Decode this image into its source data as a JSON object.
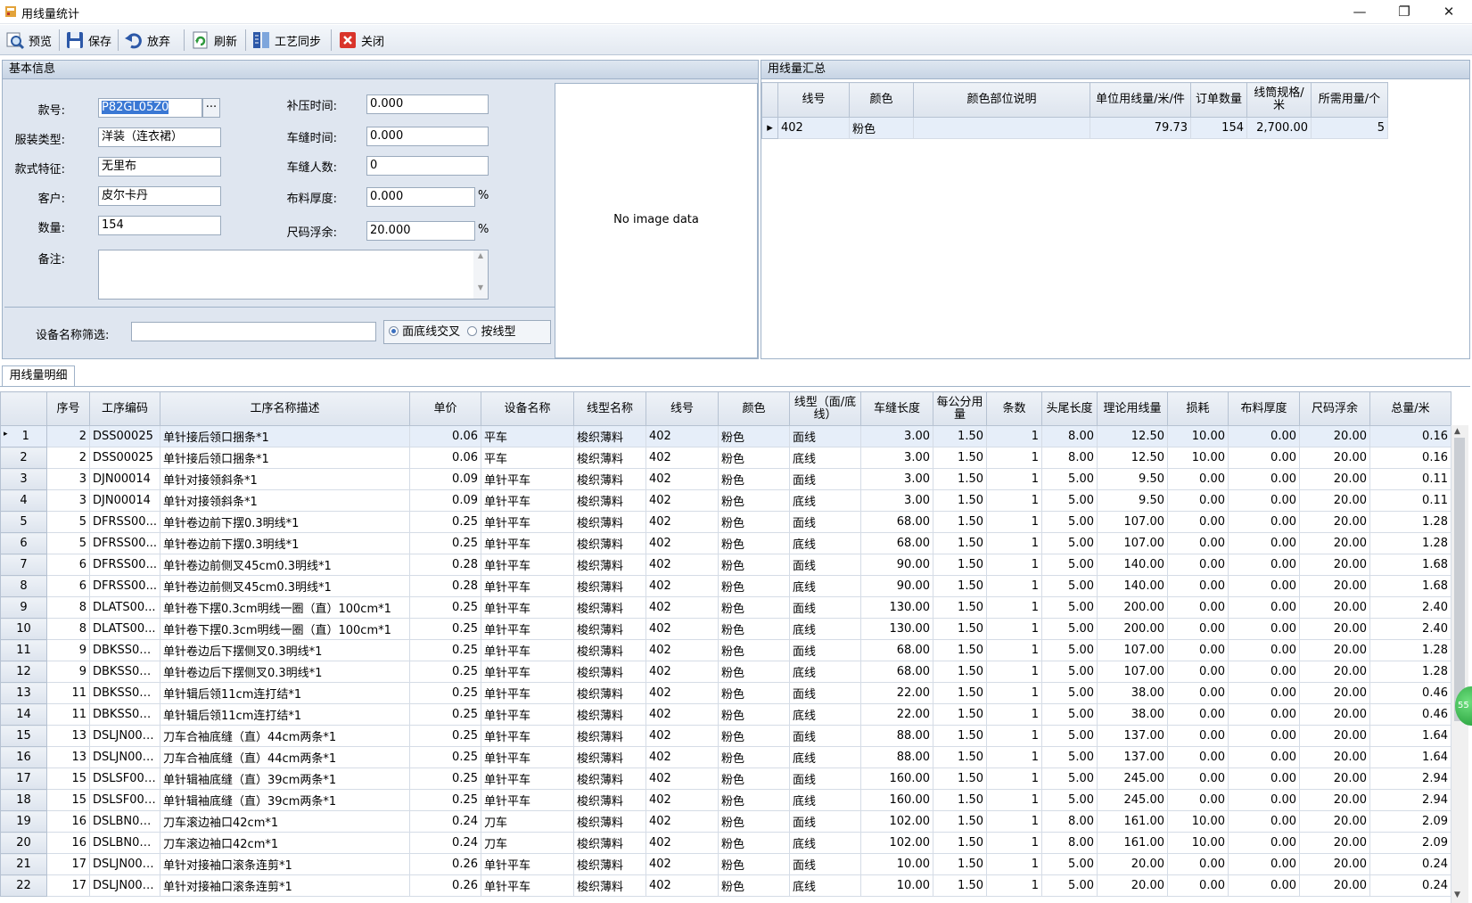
{
  "window": {
    "title": "用线量统计",
    "min": "—",
    "max": "❐",
    "close": "✕"
  },
  "toolbar": {
    "preview": "预览",
    "save": "保存",
    "discard": "放弃",
    "refresh": "刷新",
    "sync": "工艺同步",
    "close": "关闭"
  },
  "basic": {
    "header": "基本信息",
    "style_no_label": "款号:",
    "style_no": "P82GL05Z0",
    "browse": "···",
    "garment_type_label": "服装类型:",
    "garment_type": "洋装（连衣裙）",
    "feature_label": "款式特征:",
    "feature": "无里布",
    "customer_label": "客户:",
    "customer": "皮尔卡丹",
    "quantity_label": "数量:",
    "quantity": "154",
    "remark_label": "备注:",
    "remark": "",
    "press_time_label": "补压时间:",
    "press_time": "0.000",
    "sew_time_label": "车缝时间:",
    "sew_time": "0.000",
    "sew_people_label": "车缝人数:",
    "sew_people": "0",
    "fabric_thick_label": "布料厚度:",
    "fabric_thick": "0.000",
    "size_float_label": "尺码浮余:",
    "size_float": "20.000",
    "pct": "%",
    "device_filter_label": "设备名称筛选:",
    "device_filter": "",
    "radio_cross": "面底线交叉",
    "radio_by_type": "按线型",
    "no_image": "No image data"
  },
  "summary": {
    "header": "用线量汇总",
    "columns": [
      "线号",
      "颜色",
      "颜色部位说明",
      "单位用线量/米/件",
      "订单数量",
      "线筒规格/米",
      "所需用量/个"
    ],
    "rows": [
      [
        "402",
        "粉色",
        "",
        "79.73",
        "154",
        "2,700.00",
        "5"
      ]
    ]
  },
  "detail": {
    "tab": "用线量明细",
    "columns": [
      "序号",
      "工序编码",
      "工序名称描述",
      "单价",
      "设备名称",
      "线型名称",
      "线号",
      "颜色",
      "线型（面/底线）",
      "车缝长度",
      "每公分用量",
      "条数",
      "头尾长度",
      "理论用线量",
      "损耗",
      "布料厚度",
      "尺码浮余",
      "总量/米"
    ],
    "rows": [
      [
        "1",
        "2",
        "DSS00025",
        "单针接后领口捆条*1",
        "0.06",
        "平车",
        "梭织薄料",
        "402",
        "粉色",
        "面线",
        "3.00",
        "1.50",
        "1",
        "8.00",
        "12.50",
        "10.00",
        "0.00",
        "20.00",
        "0.16"
      ],
      [
        "2",
        "2",
        "DSS00025",
        "单针接后领口捆条*1",
        "0.06",
        "平车",
        "梭织薄料",
        "402",
        "粉色",
        "底线",
        "3.00",
        "1.50",
        "1",
        "8.00",
        "12.50",
        "10.00",
        "0.00",
        "20.00",
        "0.16"
      ],
      [
        "3",
        "3",
        "DJN00014",
        "单针对接领斜条*1",
        "0.09",
        "单针平车",
        "梭织薄料",
        "402",
        "粉色",
        "面线",
        "3.00",
        "1.50",
        "1",
        "5.00",
        "9.50",
        "0.00",
        "0.00",
        "20.00",
        "0.11"
      ],
      [
        "4",
        "3",
        "DJN00014",
        "单针对接领斜条*1",
        "0.09",
        "单针平车",
        "梭织薄料",
        "402",
        "粉色",
        "底线",
        "3.00",
        "1.50",
        "1",
        "5.00",
        "9.50",
        "0.00",
        "0.00",
        "20.00",
        "0.11"
      ],
      [
        "5",
        "5",
        "DFRSS00...",
        "单针卷边前下摆0.3明线*1",
        "0.25",
        "单针平车",
        "梭织薄料",
        "402",
        "粉色",
        "面线",
        "68.00",
        "1.50",
        "1",
        "5.00",
        "107.00",
        "0.00",
        "0.00",
        "20.00",
        "1.28"
      ],
      [
        "6",
        "5",
        "DFRSS00...",
        "单针卷边前下摆0.3明线*1",
        "0.25",
        "单针平车",
        "梭织薄料",
        "402",
        "粉色",
        "底线",
        "68.00",
        "1.50",
        "1",
        "5.00",
        "107.00",
        "0.00",
        "0.00",
        "20.00",
        "1.28"
      ],
      [
        "7",
        "6",
        "DFRSS00...",
        "单针卷边前侧叉45cm0.3明线*1",
        "0.28",
        "单针平车",
        "梭织薄料",
        "402",
        "粉色",
        "面线",
        "90.00",
        "1.50",
        "1",
        "5.00",
        "140.00",
        "0.00",
        "0.00",
        "20.00",
        "1.68"
      ],
      [
        "8",
        "6",
        "DFRSS00...",
        "单针卷边前侧叉45cm0.3明线*1",
        "0.28",
        "单针平车",
        "梭织薄料",
        "402",
        "粉色",
        "底线",
        "90.00",
        "1.50",
        "1",
        "5.00",
        "140.00",
        "0.00",
        "0.00",
        "20.00",
        "1.68"
      ],
      [
        "9",
        "8",
        "DLATS00...",
        "单针卷下摆0.3cm明线一圈（直）100cm*1",
        "0.25",
        "单针平车",
        "梭织薄料",
        "402",
        "粉色",
        "面线",
        "130.00",
        "1.50",
        "1",
        "5.00",
        "200.00",
        "0.00",
        "0.00",
        "20.00",
        "2.40"
      ],
      [
        "10",
        "8",
        "DLATS00...",
        "单针卷下摆0.3cm明线一圈（直）100cm*1",
        "0.25",
        "单针平车",
        "梭织薄料",
        "402",
        "粉色",
        "底线",
        "130.00",
        "1.50",
        "1",
        "5.00",
        "200.00",
        "0.00",
        "0.00",
        "20.00",
        "2.40"
      ],
      [
        "11",
        "9",
        "DBKSS00...",
        "单针卷边后下摆侧叉0.3明线*1",
        "0.25",
        "单针平车",
        "梭织薄料",
        "402",
        "粉色",
        "面线",
        "68.00",
        "1.50",
        "1",
        "5.00",
        "107.00",
        "0.00",
        "0.00",
        "20.00",
        "1.28"
      ],
      [
        "12",
        "9",
        "DBKSS00...",
        "单针卷边后下摆侧叉0.3明线*1",
        "0.25",
        "单针平车",
        "梭织薄料",
        "402",
        "粉色",
        "底线",
        "68.00",
        "1.50",
        "1",
        "5.00",
        "107.00",
        "0.00",
        "0.00",
        "20.00",
        "1.28"
      ],
      [
        "13",
        "11",
        "DBKSS00...",
        "单针辑后领11cm连打结*1",
        "0.25",
        "单针平车",
        "梭织薄料",
        "402",
        "粉色",
        "面线",
        "22.00",
        "1.50",
        "1",
        "5.00",
        "38.00",
        "0.00",
        "0.00",
        "20.00",
        "0.46"
      ],
      [
        "14",
        "11",
        "DBKSS00...",
        "单针辑后领11cm连打结*1",
        "0.25",
        "单针平车",
        "梭织薄料",
        "402",
        "粉色",
        "底线",
        "22.00",
        "1.50",
        "1",
        "5.00",
        "38.00",
        "0.00",
        "0.00",
        "20.00",
        "0.46"
      ],
      [
        "15",
        "13",
        "DSLJN000...",
        "刀车合袖底缝（直）44cm两条*1",
        "0.25",
        "单针平车",
        "梭织薄料",
        "402",
        "粉色",
        "面线",
        "88.00",
        "1.50",
        "1",
        "5.00",
        "137.00",
        "0.00",
        "0.00",
        "20.00",
        "1.64"
      ],
      [
        "16",
        "13",
        "DSLJN000...",
        "刀车合袖底缝（直）44cm两条*1",
        "0.25",
        "单针平车",
        "梭织薄料",
        "402",
        "粉色",
        "底线",
        "88.00",
        "1.50",
        "1",
        "5.00",
        "137.00",
        "0.00",
        "0.00",
        "20.00",
        "1.64"
      ],
      [
        "17",
        "15",
        "DSLSF000...",
        "单针辑袖底缝（直）39cm两条*1",
        "0.25",
        "单针平车",
        "梭织薄料",
        "402",
        "粉色",
        "面线",
        "160.00",
        "1.50",
        "1",
        "5.00",
        "245.00",
        "0.00",
        "0.00",
        "20.00",
        "2.94"
      ],
      [
        "18",
        "15",
        "DSLSF000...",
        "单针辑袖底缝（直）39cm两条*1",
        "0.25",
        "单针平车",
        "梭织薄料",
        "402",
        "粉色",
        "底线",
        "160.00",
        "1.50",
        "1",
        "5.00",
        "245.00",
        "0.00",
        "0.00",
        "20.00",
        "2.94"
      ],
      [
        "19",
        "16",
        "DSLBN00...",
        "刀车滚边袖口42cm*1",
        "0.24",
        "刀车",
        "梭织薄料",
        "402",
        "粉色",
        "面线",
        "102.00",
        "1.50",
        "1",
        "8.00",
        "161.00",
        "10.00",
        "0.00",
        "20.00",
        "2.09"
      ],
      [
        "20",
        "16",
        "DSLBN00...",
        "刀车滚边袖口42cm*1",
        "0.24",
        "刀车",
        "梭织薄料",
        "402",
        "粉色",
        "底线",
        "102.00",
        "1.50",
        "1",
        "8.00",
        "161.00",
        "10.00",
        "0.00",
        "20.00",
        "2.09"
      ],
      [
        "21",
        "17",
        "DSLJN000...",
        "单针对接袖口滚条连剪*1",
        "0.26",
        "单针平车",
        "梭织薄料",
        "402",
        "粉色",
        "面线",
        "10.00",
        "1.50",
        "1",
        "5.00",
        "20.00",
        "0.00",
        "0.00",
        "20.00",
        "0.24"
      ],
      [
        "22",
        "17",
        "DSLJN000...",
        "单针对接袖口滚条连剪*1",
        "0.26",
        "单针平车",
        "梭织薄料",
        "402",
        "粉色",
        "底线",
        "10.00",
        "1.50",
        "1",
        "5.00",
        "20.00",
        "0.00",
        "0.00",
        "20.00",
        "0.24"
      ]
    ]
  },
  "float_badge": "55"
}
